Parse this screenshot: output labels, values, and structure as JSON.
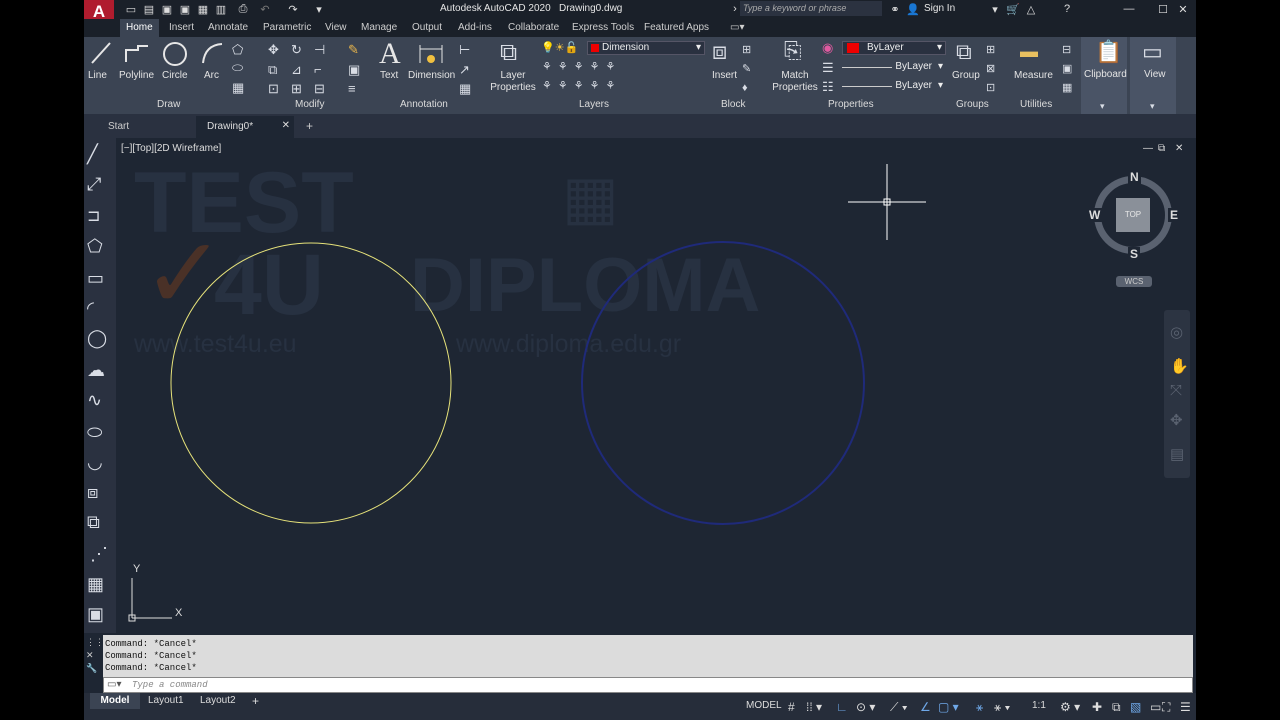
{
  "app_title": "Autodesk AutoCAD 2020",
  "doc_title": "Drawing0.dwg",
  "search_placeholder": "Type a keyword or phrase",
  "sign_in": "Sign In",
  "ribbon_tabs": [
    "Home",
    "Insert",
    "Annotate",
    "Parametric",
    "View",
    "Manage",
    "Output",
    "Add-ins",
    "Collaborate",
    "Express Tools",
    "Featured Apps"
  ],
  "draw_tools": [
    "Line",
    "Polyline",
    "Circle",
    "Arc"
  ],
  "panels": {
    "draw": "Draw",
    "modify": "Modify",
    "annotation": "Annotation",
    "layers": "Layers",
    "block": "Block",
    "properties": "Properties",
    "groups": "Groups",
    "utilities": "Utilities"
  },
  "annotation_tools": [
    "Text",
    "Dimension"
  ],
  "layer_properties": "Layer Properties",
  "current_layer": "Dimension",
  "insert": "Insert",
  "match_properties": "Match Properties",
  "bylayer": "ByLayer",
  "group": "Group",
  "measure": "Measure",
  "clipboard": "Clipboard",
  "view": "View",
  "doc_tabs": {
    "start": "Start",
    "drawing": "Drawing0*"
  },
  "viewport_label": "[−][Top][2D Wireframe]",
  "viewcube": {
    "n": "N",
    "s": "S",
    "e": "E",
    "w": "W",
    "top": "TOP",
    "wcs": "WCS"
  },
  "ucs": {
    "x": "X",
    "y": "Y"
  },
  "watermark": {
    "test": "TEST",
    "four_u": "4U",
    "diploma": "DIPLOMA",
    "url1": "www.test4u.eu",
    "url2": "www.diploma.edu.gr"
  },
  "command_history": [
    "Command: *Cancel*",
    "Command: *Cancel*",
    "Command: *Cancel*"
  ],
  "command_placeholder": "Type a command",
  "layout_tabs": [
    "Model",
    "Layout1",
    "Layout2"
  ],
  "status": {
    "model": "MODEL",
    "scale": "1:1"
  },
  "colors": {
    "circle1": "#e6e27a",
    "circle2": "#1f2a7a",
    "accent": "#c8192e"
  }
}
